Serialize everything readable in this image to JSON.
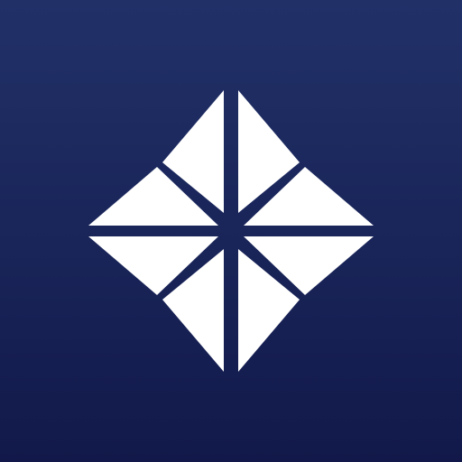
{
  "app_icon": {
    "logo_icon": "diamond-compass-logo-icon",
    "colors": {
      "background_top": "#213168",
      "background_bottom": "#12194a",
      "mark": "#ffffff"
    }
  }
}
